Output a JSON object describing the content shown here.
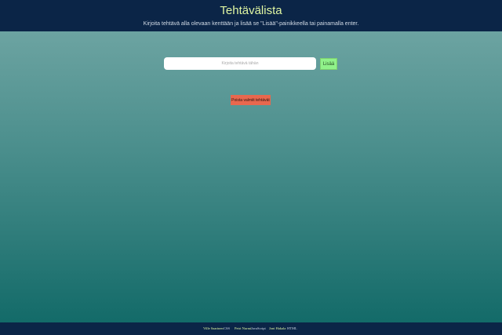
{
  "header": {
    "title": "Tehtävälista",
    "subtitle": "Kirjoita tehtävä alla olevaan kenttään ja lisää se \"Lisää\"-painikkeella tai painamalla enter."
  },
  "form": {
    "input_placeholder": "Kirjoita tehtävä tähän",
    "input_value": "",
    "add_label": "Lisää"
  },
  "tasks": [],
  "actions": {
    "clear_label": "Poista valmiit tehtävät"
  },
  "footer": {
    "credits": [
      {
        "name": "Ville Saarinen",
        "tech": "CSS"
      },
      {
        "name": "Petri Nurmi",
        "tech": "JavaScript"
      },
      {
        "name": "Joni Hakala",
        "tech": "HTML"
      }
    ]
  },
  "colors": {
    "header_bg": "#0b2547",
    "title": "#dff5a2",
    "add_button": "#90f28a",
    "clear_button": "#e8684e",
    "gradient_top": "#75a9a7",
    "gradient_bottom": "#0f6866"
  }
}
